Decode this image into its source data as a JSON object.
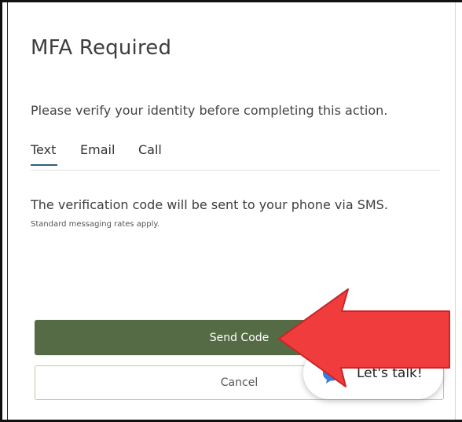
{
  "dialog": {
    "title": "MFA Required",
    "prompt": "Please verify your identity before completing this action."
  },
  "tabs": [
    {
      "label": "Text",
      "active": true
    },
    {
      "label": "Email",
      "active": false
    },
    {
      "label": "Call",
      "active": false
    }
  ],
  "text_tab": {
    "description": "The verification code will be sent to your phone via SMS.",
    "note": "Standard messaging rates apply."
  },
  "actions": {
    "send_label": "Send Code",
    "cancel_label": "Cancel"
  },
  "chat": {
    "label": "Let's talk!"
  },
  "colors": {
    "primary_button": "#556b45",
    "active_tab_underline": "#2b5f78",
    "annotation_arrow": "#f03c3c",
    "chat_icon": "#3a7be0"
  },
  "icons": {
    "chat": "chat-bubble-icon",
    "annotation": "red-arrow"
  }
}
